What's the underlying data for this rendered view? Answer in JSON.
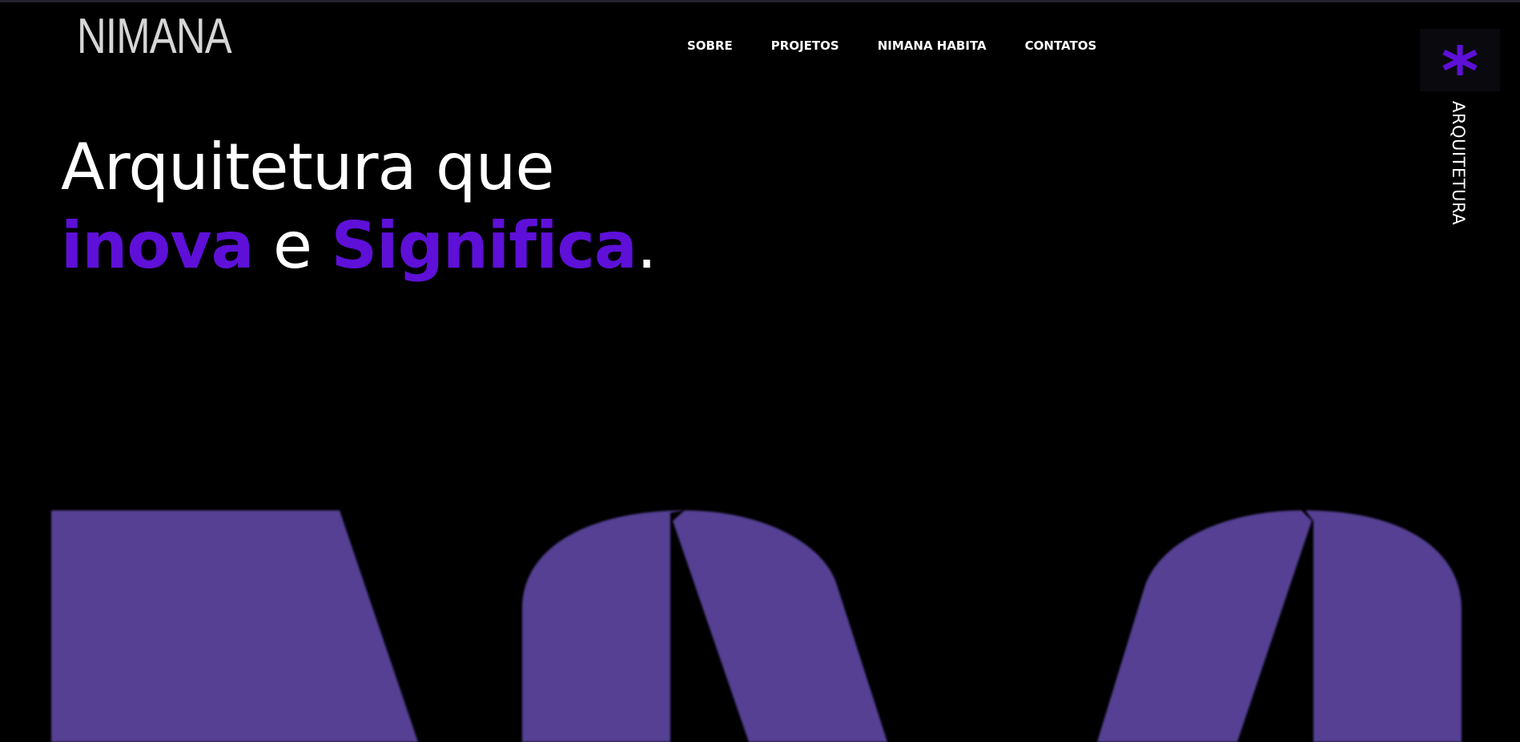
{
  "brand": {
    "logo_text": "NIMANA"
  },
  "nav": {
    "items": [
      {
        "label": "SOBRE"
      },
      {
        "label": "PROJETOS"
      },
      {
        "label": "NIMANA HABITA"
      },
      {
        "label": "CONTATOS"
      }
    ]
  },
  "side_tab": {
    "icon": "asterisk-icon",
    "label": "ARQUITETURA"
  },
  "hero": {
    "line1": "Arquitetura que",
    "word_accent_1": "inova",
    "connector": " e ",
    "word_accent_2": "Significa",
    "period": "."
  },
  "colors": {
    "background": "#000000",
    "accent": "#5e10d8",
    "graphic": "#544194",
    "logo": "#d6d6d6"
  }
}
